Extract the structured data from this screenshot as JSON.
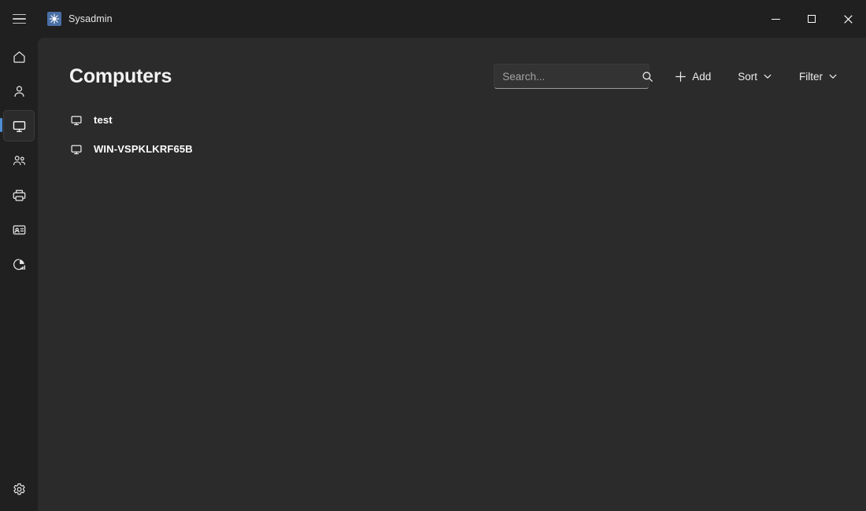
{
  "window": {
    "app_name": "Sysadmin",
    "app_icon": "sysadmin-starburst-icon",
    "menu_icon": "hamburger-menu-icon",
    "controls": {
      "minimize": "minimize-icon",
      "maximize": "maximize-icon",
      "close": "close-icon"
    }
  },
  "sidebar": {
    "items": [
      {
        "name": "home",
        "icon": "home-icon",
        "selected": false
      },
      {
        "name": "user",
        "icon": "person-icon",
        "selected": false
      },
      {
        "name": "computers",
        "icon": "monitor-icon",
        "selected": true
      },
      {
        "name": "groups",
        "icon": "people-group-icon",
        "selected": false
      },
      {
        "name": "printers",
        "icon": "printer-icon",
        "selected": false
      },
      {
        "name": "contacts",
        "icon": "contact-card-icon",
        "selected": false
      },
      {
        "name": "reports",
        "icon": "pie-chart-icon",
        "selected": false
      }
    ],
    "bottom": {
      "name": "settings",
      "icon": "gear-icon"
    }
  },
  "main": {
    "title": "Computers",
    "search": {
      "placeholder": "Search...",
      "value": "",
      "icon": "search-icon"
    },
    "toolbar": {
      "add_label": "Add",
      "add_icon": "plus-icon",
      "sort_label": "Sort",
      "sort_icon": "chevron-down-icon",
      "filter_label": "Filter",
      "filter_icon": "chevron-down-icon"
    },
    "list": {
      "items": [
        {
          "label": "test",
          "icon": "monitor-icon"
        },
        {
          "label": "WIN-VSPKLKRF65B",
          "icon": "monitor-icon"
        }
      ]
    }
  },
  "colors": {
    "window_bg": "#202020",
    "panel_bg": "#2b2b2b",
    "accent": "#4f8ed6",
    "text_primary": "#ffffff",
    "text_secondary": "#a3a3a3"
  }
}
